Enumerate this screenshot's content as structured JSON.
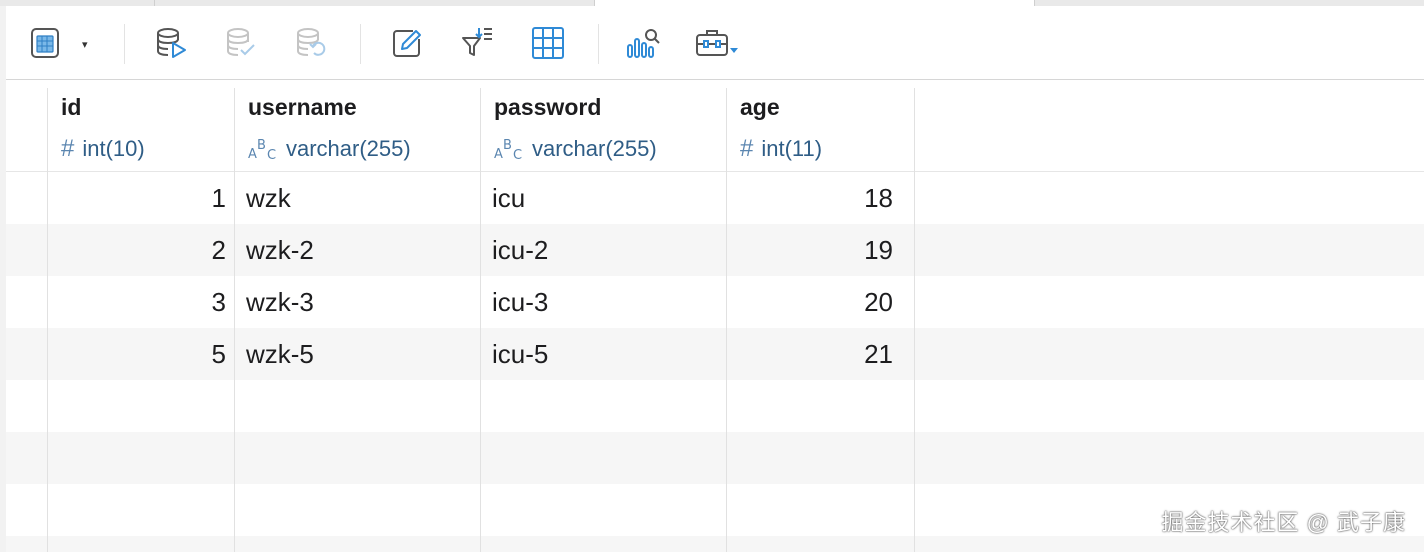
{
  "toolbar": {
    "buttons": [
      {
        "name": "table-view-icon"
      },
      {
        "name": "dropdown-caret",
        "label": "▾"
      },
      {
        "name": "run-query-icon"
      },
      {
        "name": "commit-icon"
      },
      {
        "name": "rollback-icon"
      },
      {
        "name": "edit-icon"
      },
      {
        "name": "filter-sort-icon"
      },
      {
        "name": "grid-icon"
      },
      {
        "name": "chart-icon"
      },
      {
        "name": "tools-icon"
      }
    ]
  },
  "columns": [
    {
      "name": "id",
      "type": "int(10)",
      "type_icon": "hash-icon",
      "align": "right"
    },
    {
      "name": "username",
      "type": "varchar(255)",
      "type_icon": "abc-icon",
      "align": "left"
    },
    {
      "name": "password",
      "type": "varchar(255)",
      "type_icon": "abc-icon",
      "align": "left"
    },
    {
      "name": "age",
      "type": "int(11)",
      "type_icon": "hash-icon",
      "align": "right"
    }
  ],
  "rows": [
    [
      "1",
      "wzk",
      "icu",
      "18"
    ],
    [
      "2",
      "wzk-2",
      "icu-2",
      "19"
    ],
    [
      "3",
      "wzk-3",
      "icu-3",
      "20"
    ],
    [
      "5",
      "wzk-5",
      "icu-5",
      "21"
    ]
  ],
  "watermark": "掘金技术社区 @ 武子康",
  "colors": {
    "accent": "#2f8ad6",
    "type_text": "#2f5d86",
    "stripe": "#f6f6f6"
  }
}
